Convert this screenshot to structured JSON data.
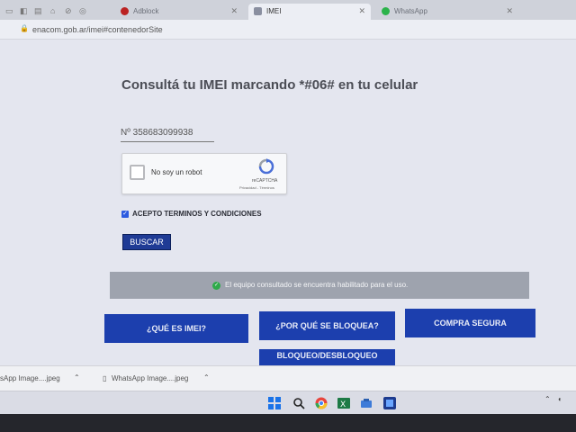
{
  "browser": {
    "tabs": [
      {
        "label": "Adblock"
      },
      {
        "label": "IMEI"
      },
      {
        "label": "WhatsApp"
      }
    ],
    "url": "enacom.gob.ar/imei#contenedorSite"
  },
  "page": {
    "title": "Consultá tu IMEI marcando *#06# en tu celular",
    "imei_field": "Nº  358683099938",
    "recaptcha": {
      "label": "No soy un robot",
      "brand": "reCAPTCHA",
      "links": "Privacidad - Términos"
    },
    "terms_label": "ACEPTO TERMINOS Y CONDICIONES",
    "search_button": "BUSCAR",
    "result_message": "El equipo consultado se encuentra habilitado para el uso.",
    "nav_buttons": [
      {
        "label": "¿QUÉ ES IMEI?"
      },
      {
        "label": "¿POR QUÉ SE BLOQUEA?"
      },
      {
        "label": "COMPRA SEGURA"
      },
      {
        "label": "BLOQUEO/DESBLOQUEO"
      }
    ]
  },
  "downloads": [
    {
      "label": "sApp Image....jpeg"
    },
    {
      "label": "WhatsApp Image....jpeg"
    }
  ],
  "colors": {
    "brand_blue": "#1c3fae",
    "result_bg": "#9ea3ae",
    "success_green": "#2faa4a"
  },
  "taskbar": {
    "icons": [
      "windows-start-icon",
      "search-icon",
      "chrome-icon",
      "excel-icon",
      "app-icon",
      "file-explorer-icon",
      "browser-icon"
    ]
  }
}
